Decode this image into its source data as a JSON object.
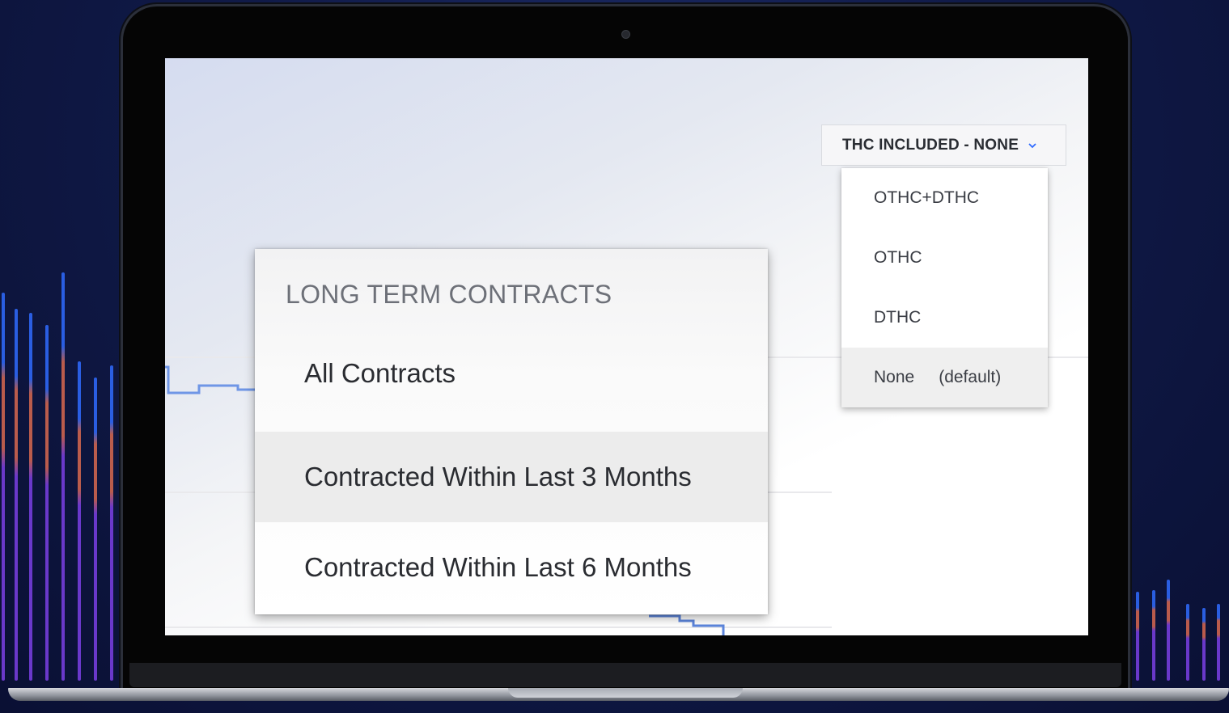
{
  "thc_filter": {
    "button_label": "THC INCLUDED - NONE",
    "chevron_icon": "chevron-down-icon",
    "options": [
      {
        "label": "OTHC+DTHC",
        "tag": "",
        "selected": false
      },
      {
        "label": "OTHC",
        "tag": "",
        "selected": false
      },
      {
        "label": "DTHC",
        "tag": "",
        "selected": false
      },
      {
        "label": "None",
        "tag": "(default)",
        "selected": true
      }
    ]
  },
  "long_term_contracts": {
    "heading": "LONG TERM CONTRACTS",
    "options": [
      {
        "label": "All Contracts",
        "selected": false
      },
      {
        "label": "Contracted Within Last 3 Months",
        "selected": true
      },
      {
        "label": "Contracted Within Last 6 Months",
        "selected": false
      }
    ]
  },
  "colors": {
    "accent_blue": "#2f6bff",
    "line_blue": "#6f96e6",
    "bar_blue": "#2f6bff",
    "bar_orange": "#d9684f",
    "bar_purple": "#7b3fe4",
    "selected_row": "#ececec"
  }
}
